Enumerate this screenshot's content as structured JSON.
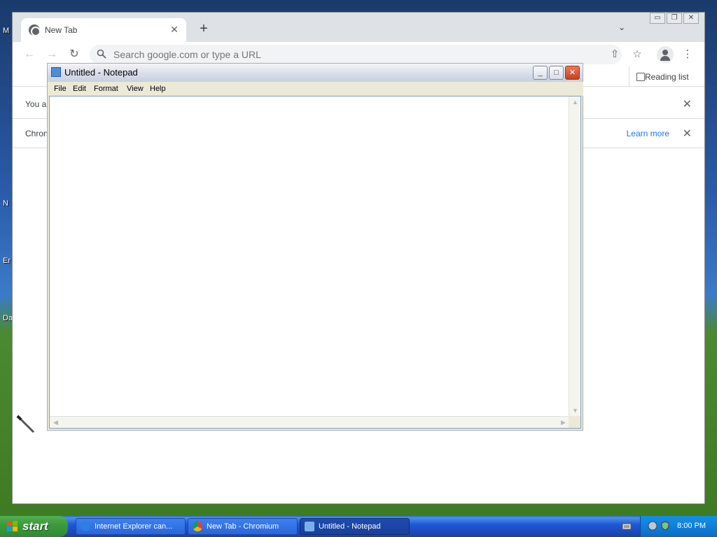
{
  "desktop": {
    "icon_labels": [
      "M",
      "N",
      "Er",
      "Da"
    ]
  },
  "chrome": {
    "tab": {
      "title": "New Tab",
      "close": "✕"
    },
    "new_tab": "+",
    "tab_search": "⌄",
    "window_controls": {
      "minimize": "▭",
      "maximize": "❐",
      "close": "✕"
    },
    "toolbar": {
      "back": "←",
      "forward": "→",
      "reload": "↻",
      "omnibox_placeholder": "Search google.com or type a URL",
      "share": "⇧",
      "bookmark": "☆",
      "menu": "⋮"
    },
    "reading_list": "Reading list",
    "infobars": [
      {
        "text": "You a",
        "close": "✕"
      },
      {
        "text": "Chron",
        "learn_more": "Learn more",
        "close": "✕"
      }
    ]
  },
  "notepad": {
    "title": "Untitled - Notepad",
    "menus": [
      "File",
      "Edit",
      "Format",
      "View",
      "Help"
    ],
    "controls": {
      "minimize": "_",
      "maximize": "□",
      "close": "✕"
    },
    "content": ""
  },
  "taskbar": {
    "start_label": "start",
    "items": [
      {
        "label": "Internet Explorer can...",
        "active": false
      },
      {
        "label": "New Tab - Chromium",
        "active": false
      },
      {
        "label": "Untitled - Notepad",
        "active": true
      }
    ],
    "clock": "8:00 PM"
  },
  "colors": {
    "xp_blue": "#2157d7",
    "start_green": "#3c9a3c",
    "chrome_link": "#1a73e8",
    "notepad_close": "#c6421e"
  }
}
